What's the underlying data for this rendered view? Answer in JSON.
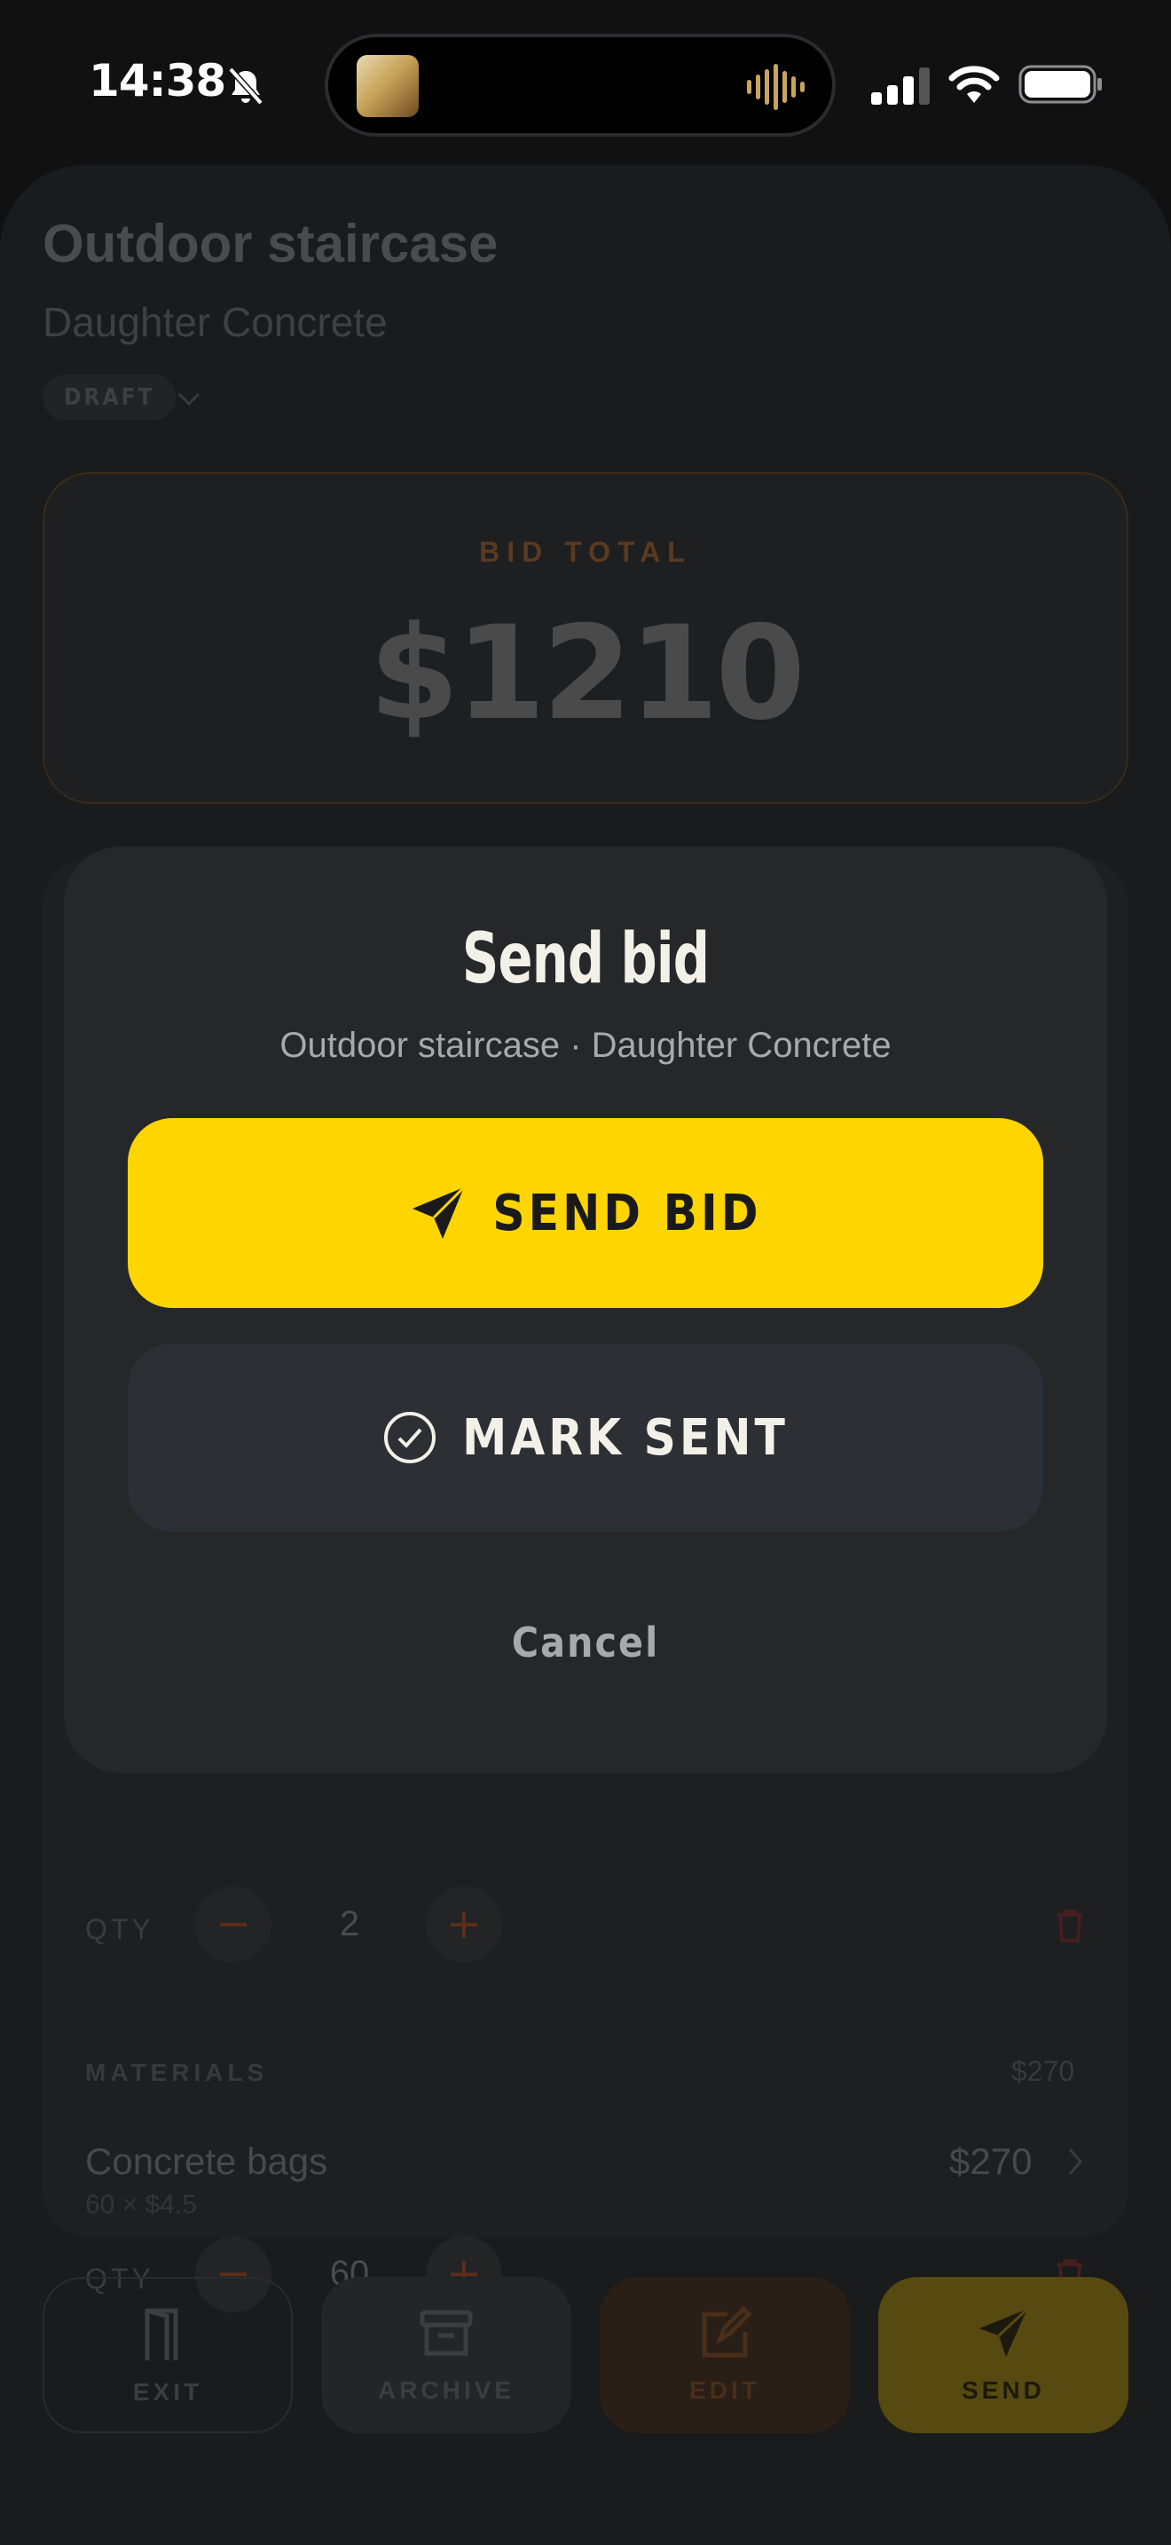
{
  "status_bar": {
    "time": "14:38",
    "icons": [
      "bell-slash-icon",
      "now-playing-artwork",
      "audio-waveform-icon",
      "cellular-signal-icon",
      "wifi-icon",
      "battery-icon"
    ]
  },
  "project": {
    "title": "Outdoor staircase",
    "client": "Daughter Concrete",
    "status": "DRAFT"
  },
  "bid": {
    "label": "BID TOTAL",
    "total": "$1210"
  },
  "line_items": {
    "qty_label": "QTY",
    "labor_qty": "2",
    "materials": {
      "section_label": "MATERIALS",
      "section_total": "$270",
      "item_name": "Concrete bags",
      "item_meta": "60 × $4.5",
      "item_price": "$270",
      "qty": "60"
    }
  },
  "bottom_bar": {
    "exit": "EXIT",
    "archive": "ARCHIVE",
    "edit": "EDIT",
    "send": "SEND"
  },
  "modal": {
    "title": "Send bid",
    "subtitle": "Outdoor staircase · Daughter Concrete",
    "send_button": "SEND BID",
    "mark_sent_button": "MARK SENT",
    "cancel_button": "Cancel"
  },
  "colors": {
    "accent_yellow": "#ffd500",
    "modal_bg": "#262729",
    "screen_bg": "#111112",
    "accent_orange": "#e06a1a"
  }
}
